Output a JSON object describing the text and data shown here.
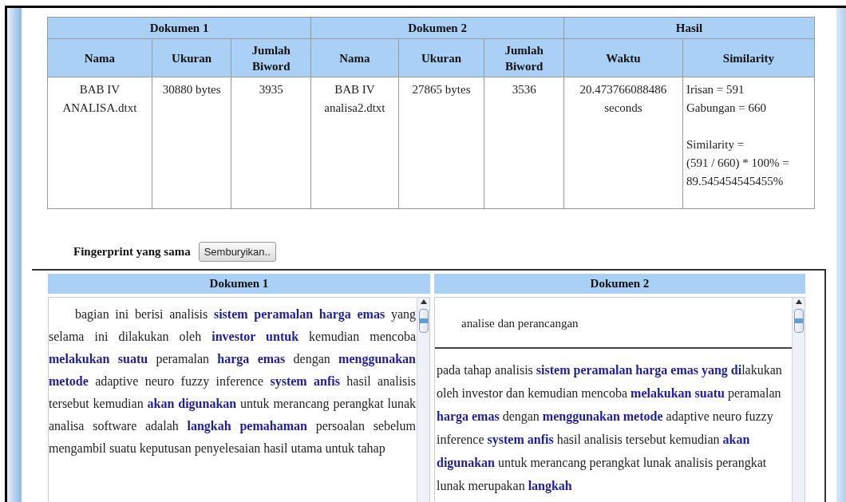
{
  "table": {
    "groups": [
      {
        "label": "Dokumen 1",
        "columns": [
          "Nama",
          "Ukuran",
          "Jumlah Biword"
        ]
      },
      {
        "label": "Dokumen 2",
        "columns": [
          "Nama",
          "Ukuran",
          "Jumlah Biword"
        ]
      },
      {
        "label": "Hasil",
        "columns": [
          "Waktu",
          "Similarity"
        ]
      }
    ],
    "rows": [
      {
        "cells": [
          [
            [
              "BAB IV ANALISA.dtxt"
            ]
          ],
          [
            [
              "30880 bytes"
            ]
          ],
          [
            [
              "3935"
            ]
          ],
          [
            [
              "BAB IV analisa2.dtxt"
            ]
          ],
          [
            [
              "27865 bytes"
            ]
          ],
          [
            [
              "3536"
            ]
          ],
          [
            [
              "20.473766088486 seconds"
            ]
          ],
          [
            [
              "Irisan = 591",
              "Gabungan = 660"
            ],
            [
              "Similarity =",
              "(591 / 660) * 100% =",
              "89.545454545455%"
            ]
          ]
        ]
      }
    ]
  },
  "fingerprint": {
    "label": "Fingerprint yang sama",
    "button": "Semburyikan.."
  },
  "documents": [
    {
      "title": "Dokumen 1",
      "text": "bagian ini berisi analisis **sistem peramalan harga emas** yang selama ini dilakukan oleh **investor untuk** kemudian mencoba **melakukan suatu** peramalan **harga emas** dengan **menggunakan metode** adaptive neuro fuzzy inference **system anfis** hasil analisis tersebut kemudian **akan digunakan** untuk merancang perangkat lunak analisa software adalah **langkah pemahaman** persoalan sebelum mengambil suatu keputusan penyelesaian hasil utama untuk tahap"
    },
    {
      "title": "Dokumen 2",
      "header_text": "analise dan perancangan",
      "text": "pada tahap analisis **sistem peramalan harga emas yang** **di**lakukan oleh investor dan kemudian mencoba **melakukan suatu** peramalan **harga emas** dengan **menggunakan metode** adaptive neuro fuzzy inference **system anfis** hasil analisis tersebut kemudian **akan digunakan** untuk merancang perangkat lunak analisis perangkat lunak merupakan **langkah**"
    }
  ]
}
